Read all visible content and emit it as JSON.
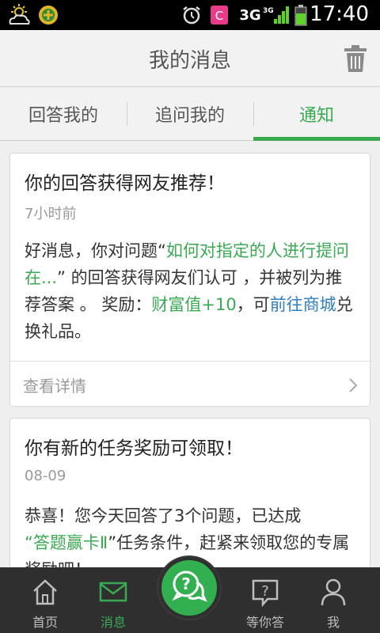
{
  "status_bar": {
    "network_1": "3G",
    "network_2": "3G",
    "time": "17:40"
  },
  "header": {
    "title": "我的消息"
  },
  "tabs": [
    {
      "label": "回答我的",
      "active": false
    },
    {
      "label": "追问我的",
      "active": false
    },
    {
      "label": "通知",
      "active": true
    }
  ],
  "messages": [
    {
      "title": "你的回答获得网友推荐！",
      "date": "7小时前",
      "body_1": "好消息，你对问题“",
      "link_question": "如何对指定的人进行提问 在...",
      "body_2": "” 的回答获得网友们认可 ，并被列为推荐答案 。 奖励：",
      "reward": "财富值+10",
      "body_3": "，可",
      "link_shop": "前往商城",
      "body_4": "兑换礼品。",
      "action_label": "查看详情"
    },
    {
      "title": "你有新的任务奖励可领取！",
      "date": "08-09",
      "body_1": "恭喜！您今天回答了3个问题，已达成",
      "quote_open": "“",
      "task_name": "答题赢卡Ⅱ",
      "body_2": "”任务条件，赶紧来领取您的专属奖励吧！"
    }
  ],
  "bottom_nav": [
    {
      "label": "首页",
      "icon": "home-icon",
      "active": false
    },
    {
      "label": "消息",
      "icon": "mail-icon",
      "active": true
    },
    {
      "label": "等你答",
      "icon": "question-doc-icon",
      "active": false
    },
    {
      "label": "我",
      "icon": "person-icon",
      "active": false
    }
  ],
  "colors": {
    "accent": "#3aaa52",
    "link": "#2e7fc1",
    "status_bar": "#000000",
    "bottom_nav": "#2f2f2f"
  }
}
